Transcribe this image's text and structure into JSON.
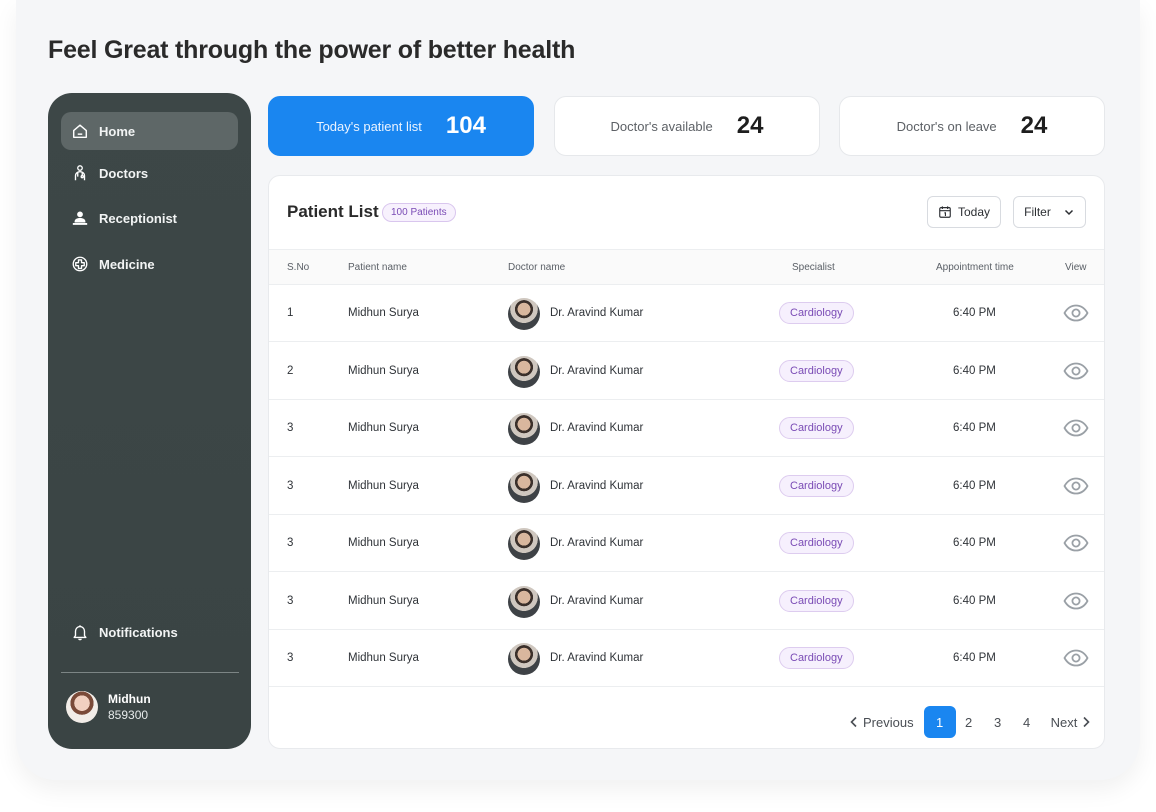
{
  "page": {
    "title": "Feel Great through the power of better health"
  },
  "sidebar": {
    "items": [
      {
        "label": "Home",
        "icon": "home-icon",
        "active": true
      },
      {
        "label": "Doctors",
        "icon": "stethoscope-icon",
        "active": false
      },
      {
        "label": "Receptionist",
        "icon": "receptionist-icon",
        "active": false
      },
      {
        "label": "Medicine",
        "icon": "medicine-icon",
        "active": false
      }
    ],
    "notifications_label": "Notifications",
    "user": {
      "name": "Midhun",
      "id": "859300"
    }
  },
  "stats": [
    {
      "label": "Today's patient list",
      "value": "104"
    },
    {
      "label": "Doctor's available",
      "value": "24"
    },
    {
      "label": "Doctor's on leave",
      "value": "24"
    }
  ],
  "patient_list": {
    "title": "Patient List",
    "count_badge": "100 Patients",
    "today_button": "Today",
    "filter_button": "Filter",
    "columns": [
      "S.No",
      "Patient name",
      "Doctor name",
      "Specialist",
      "Appointment time",
      "View"
    ],
    "rows": [
      {
        "sno": "1",
        "patient": "Midhun Surya",
        "doctor": "Dr. Aravind Kumar",
        "specialist": "Cardiology",
        "time": "6:40 PM"
      },
      {
        "sno": "2",
        "patient": "Midhun Surya",
        "doctor": "Dr. Aravind Kumar",
        "specialist": "Cardiology",
        "time": "6:40 PM"
      },
      {
        "sno": "3",
        "patient": "Midhun Surya",
        "doctor": "Dr. Aravind Kumar",
        "specialist": "Cardiology",
        "time": "6:40 PM"
      },
      {
        "sno": "3",
        "patient": "Midhun Surya",
        "doctor": "Dr. Aravind Kumar",
        "specialist": "Cardiology",
        "time": "6:40 PM"
      },
      {
        "sno": "3",
        "patient": "Midhun Surya",
        "doctor": "Dr. Aravind Kumar",
        "specialist": "Cardiology",
        "time": "6:40 PM"
      },
      {
        "sno": "3",
        "patient": "Midhun Surya",
        "doctor": "Dr. Aravind Kumar",
        "specialist": "Cardiology",
        "time": "6:40 PM"
      },
      {
        "sno": "3",
        "patient": "Midhun Surya",
        "doctor": "Dr. Aravind Kumar",
        "specialist": "Cardiology",
        "time": "6:40 PM"
      }
    ]
  },
  "pagination": {
    "previous": "Previous",
    "next": "Next",
    "pages": [
      "1",
      "2",
      "3",
      "4"
    ],
    "current": "1"
  },
  "colors": {
    "accent": "#1a86f0",
    "sidebar": "#3d4747",
    "badge_text": "#7a4bb5"
  }
}
